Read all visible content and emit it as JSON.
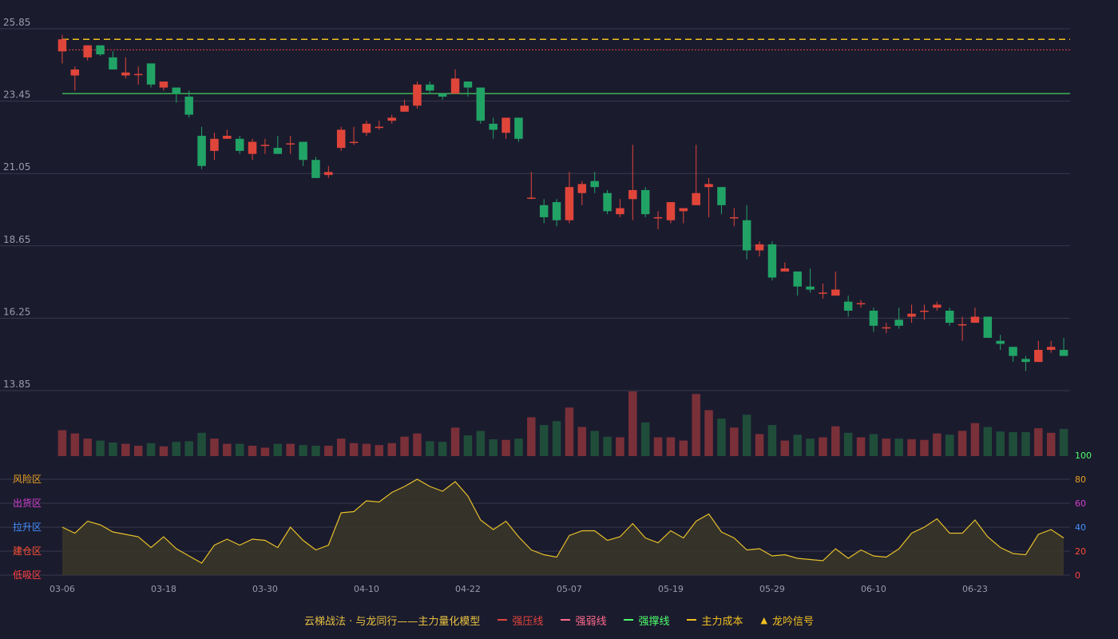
{
  "colors": {
    "background": "#1b1b2e",
    "up": "#e0453a",
    "down": "#21a366",
    "vol_up": "#7a3038",
    "vol_down": "#1f4d3a",
    "grid": "#3a3a4e",
    "axis_text": "#9a9aaa",
    "osc_line": "#e6c02a",
    "osc_fill": "#3a3628",
    "strong_pressure": "#e0453a",
    "strong_weak": "#ff6b8a",
    "strong_support": "#4cff6a",
    "main_cost": "#f0c020",
    "signal": "#f0c020",
    "title": "#e6c040"
  },
  "legend": {
    "title": "云梯战法 · 与龙同行——主力量化模型",
    "items": [
      {
        "label": "强压线",
        "color": "#e0453a",
        "style": "solid",
        "icon": "solid-line-icon"
      },
      {
        "label": "强弱线",
        "color": "#ff6b8a",
        "style": "dashed",
        "icon": "dashed-line-icon"
      },
      {
        "label": "强撑线",
        "color": "#4cff6a",
        "style": "solid",
        "icon": "solid-line-icon"
      },
      {
        "label": "主力成本",
        "color": "#f0c020",
        "style": "dashed",
        "icon": "dashed-line-icon"
      },
      {
        "label": "龙吟信号",
        "color": "#f0c020",
        "style": "triangle",
        "icon": "triangle-up-icon"
      }
    ]
  },
  "chart_data": {
    "type": "candlestick",
    "price_axis": {
      "ticks": [
        "25.85",
        "23.45",
        "21.05",
        "18.65",
        "16.25",
        "13.85"
      ],
      "ylim": [
        13.85,
        25.85
      ]
    },
    "x_ticks": [
      {
        "index": 0,
        "label": "03-06"
      },
      {
        "index": 8,
        "label": "03-18"
      },
      {
        "index": 16,
        "label": "03-30"
      },
      {
        "index": 24,
        "label": "04-10"
      },
      {
        "index": 32,
        "label": "04-22"
      },
      {
        "index": 40,
        "label": "05-07"
      },
      {
        "index": 48,
        "label": "05-19"
      },
      {
        "index": 56,
        "label": "05-29"
      },
      {
        "index": 64,
        "label": "06-10"
      },
      {
        "index": 72,
        "label": "06-23"
      }
    ],
    "reference_lines": [
      {
        "name": "强压线",
        "value": 25.15,
        "color": "#e0453a",
        "style": "dashed"
      },
      {
        "name": "强撑线",
        "value": 23.7,
        "color": "#4cff6a",
        "style": "solid"
      },
      {
        "name": "主力成本",
        "value": 25.5,
        "color": "#f0c020",
        "style": "dashed"
      }
    ],
    "candles": [
      [
        25.1,
        25.5,
        25.65,
        24.7
      ],
      [
        24.3,
        24.5,
        24.6,
        23.8
      ],
      [
        24.9,
        25.3,
        25.3,
        24.8
      ],
      [
        25.3,
        25.0,
        25.3,
        24.95
      ],
      [
        24.9,
        24.5,
        25.1,
        24.5
      ],
      [
        24.3,
        24.4,
        24.9,
        24.2
      ],
      [
        24.35,
        24.35,
        24.6,
        24.0
      ],
      [
        24.7,
        24.0,
        24.7,
        23.9
      ],
      [
        23.9,
        24.1,
        24.1,
        23.8
      ],
      [
        23.9,
        23.7,
        23.9,
        23.4
      ],
      [
        23.6,
        23.0,
        23.8,
        22.9
      ],
      [
        22.3,
        21.3,
        22.6,
        21.2
      ],
      [
        21.8,
        22.2,
        22.4,
        21.5
      ],
      [
        22.2,
        22.3,
        22.5,
        22.2
      ],
      [
        22.2,
        21.8,
        22.3,
        21.7
      ],
      [
        21.7,
        22.1,
        22.2,
        21.5
      ],
      [
        22.0,
        22.0,
        22.2,
        21.7
      ],
      [
        21.9,
        21.7,
        22.3,
        21.7
      ],
      [
        22.05,
        22.05,
        22.3,
        21.7
      ],
      [
        22.1,
        21.5,
        22.1,
        21.3
      ],
      [
        21.5,
        20.9,
        21.6,
        20.9
      ],
      [
        21.0,
        21.1,
        21.3,
        20.9
      ],
      [
        21.9,
        22.5,
        22.6,
        21.8
      ],
      [
        22.1,
        22.1,
        22.6,
        22.0
      ],
      [
        22.4,
        22.7,
        22.8,
        22.3
      ],
      [
        22.6,
        22.6,
        22.8,
        22.5
      ],
      [
        22.8,
        22.9,
        23.0,
        22.7
      ],
      [
        23.1,
        23.3,
        23.5,
        23.1
      ],
      [
        23.3,
        24.0,
        24.1,
        23.2
      ],
      [
        24.0,
        23.8,
        24.1,
        23.7
      ],
      [
        23.7,
        23.6,
        23.7,
        23.5
      ],
      [
        23.7,
        24.2,
        24.5,
        23.7
      ],
      [
        24.1,
        23.9,
        24.1,
        23.6
      ],
      [
        23.9,
        22.8,
        23.9,
        22.7
      ],
      [
        22.7,
        22.5,
        22.9,
        22.2
      ],
      [
        22.4,
        22.9,
        22.9,
        22.2
      ],
      [
        22.9,
        22.2,
        22.9,
        22.1
      ],
      [
        20.25,
        20.25,
        21.1,
        20.2
      ],
      [
        20.0,
        19.6,
        20.2,
        19.4
      ],
      [
        20.1,
        19.5,
        20.2,
        19.3
      ],
      [
        19.5,
        20.6,
        21.1,
        19.4
      ],
      [
        20.4,
        20.7,
        20.8,
        20.0
      ],
      [
        20.8,
        20.6,
        21.1,
        20.4
      ],
      [
        20.4,
        19.8,
        20.5,
        19.7
      ],
      [
        19.7,
        19.9,
        20.2,
        19.6
      ],
      [
        20.2,
        20.5,
        22.0,
        19.5
      ],
      [
        20.5,
        19.7,
        20.6,
        19.6
      ],
      [
        19.6,
        19.6,
        19.8,
        19.2
      ],
      [
        19.5,
        20.1,
        20.1,
        19.4
      ],
      [
        19.8,
        19.9,
        19.9,
        19.4
      ],
      [
        20.0,
        20.4,
        22.0,
        20.0
      ],
      [
        20.6,
        20.7,
        20.9,
        19.6
      ],
      [
        20.6,
        20.0,
        20.6,
        19.7
      ],
      [
        19.6,
        19.6,
        19.9,
        19.3
      ],
      [
        19.5,
        18.5,
        20.0,
        18.2
      ],
      [
        18.5,
        18.7,
        18.8,
        18.3
      ],
      [
        18.7,
        17.6,
        18.8,
        17.5
      ],
      [
        17.8,
        17.9,
        18.1,
        17.8
      ],
      [
        17.8,
        17.3,
        17.8,
        17.0
      ],
      [
        17.3,
        17.2,
        17.9,
        17.1
      ],
      [
        17.1,
        17.1,
        17.4,
        16.9
      ],
      [
        17.0,
        17.2,
        17.8,
        17.0
      ],
      [
        16.8,
        16.5,
        17.0,
        16.3
      ],
      [
        16.75,
        16.75,
        16.85,
        16.6
      ],
      [
        16.5,
        16.0,
        16.6,
        15.8
      ],
      [
        15.95,
        15.95,
        16.1,
        15.75
      ],
      [
        16.2,
        16.0,
        16.6,
        15.9
      ],
      [
        16.3,
        16.4,
        16.7,
        16.1
      ],
      [
        16.5,
        16.5,
        16.7,
        16.2
      ],
      [
        16.6,
        16.7,
        16.8,
        16.5
      ],
      [
        16.5,
        16.1,
        16.6,
        16.0
      ],
      [
        16.05,
        16.05,
        16.3,
        15.5
      ],
      [
        16.1,
        16.3,
        16.6,
        16.1
      ],
      [
        16.3,
        15.6,
        16.3,
        15.6
      ],
      [
        15.5,
        15.4,
        15.7,
        15.2
      ],
      [
        15.3,
        15.0,
        15.3,
        14.8
      ],
      [
        14.9,
        14.8,
        15.0,
        14.5
      ],
      [
        14.8,
        15.2,
        15.5,
        14.8
      ],
      [
        15.2,
        15.3,
        15.5,
        15.1
      ],
      [
        15.2,
        15.0,
        15.6,
        15.0
      ]
    ],
    "volume": [
      0.4,
      0.35,
      0.27,
      0.24,
      0.21,
      0.19,
      0.16,
      0.2,
      0.15,
      0.22,
      0.23,
      0.36,
      0.27,
      0.19,
      0.19,
      0.16,
      0.13,
      0.19,
      0.19,
      0.17,
      0.16,
      0.16,
      0.27,
      0.2,
      0.19,
      0.17,
      0.2,
      0.3,
      0.35,
      0.23,
      0.22,
      0.44,
      0.32,
      0.39,
      0.26,
      0.25,
      0.27,
      0.6,
      0.48,
      0.54,
      0.75,
      0.45,
      0.39,
      0.3,
      0.29,
      1.0,
      0.52,
      0.29,
      0.29,
      0.24,
      0.96,
      0.71,
      0.58,
      0.44,
      0.64,
      0.34,
      0.48,
      0.24,
      0.33,
      0.27,
      0.29,
      0.46,
      0.36,
      0.29,
      0.34,
      0.27,
      0.27,
      0.26,
      0.25,
      0.35,
      0.33,
      0.39,
      0.51,
      0.45,
      0.38,
      0.37,
      0.37,
      0.43,
      0.36,
      0.42
    ],
    "oscillator": {
      "ylim": [
        0,
        100
      ],
      "ticks": [
        0,
        20,
        40,
        60,
        80,
        100
      ],
      "zones": [
        {
          "label": "风险区",
          "level": 80,
          "color": "#e6a020"
        },
        {
          "label": "出货区",
          "level": 60,
          "color": "#d040d0"
        },
        {
          "label": "拉升区",
          "level": 40,
          "color": "#4090ff"
        },
        {
          "label": "建仓区",
          "level": 20,
          "color": "#ff5030"
        },
        {
          "label": "低吸区",
          "level": 0,
          "color": "#ff4040"
        }
      ],
      "values": [
        40,
        35,
        45,
        42,
        36,
        34,
        32,
        23,
        32,
        22,
        16,
        10,
        25,
        30,
        25,
        30,
        29,
        23,
        40,
        29,
        21,
        25,
        52,
        53,
        62,
        61,
        69,
        74,
        80,
        74,
        70,
        78,
        66,
        46,
        38,
        45,
        32,
        21,
        17,
        15,
        33,
        37,
        37,
        29,
        32,
        43,
        31,
        27,
        37,
        31,
        45,
        51,
        36,
        31,
        21,
        22,
        16,
        17,
        14,
        13,
        12,
        22,
        14,
        21,
        16,
        15,
        22,
        35,
        40,
        47,
        35,
        35,
        46,
        32,
        23,
        18,
        17,
        34,
        38,
        31
      ]
    }
  }
}
